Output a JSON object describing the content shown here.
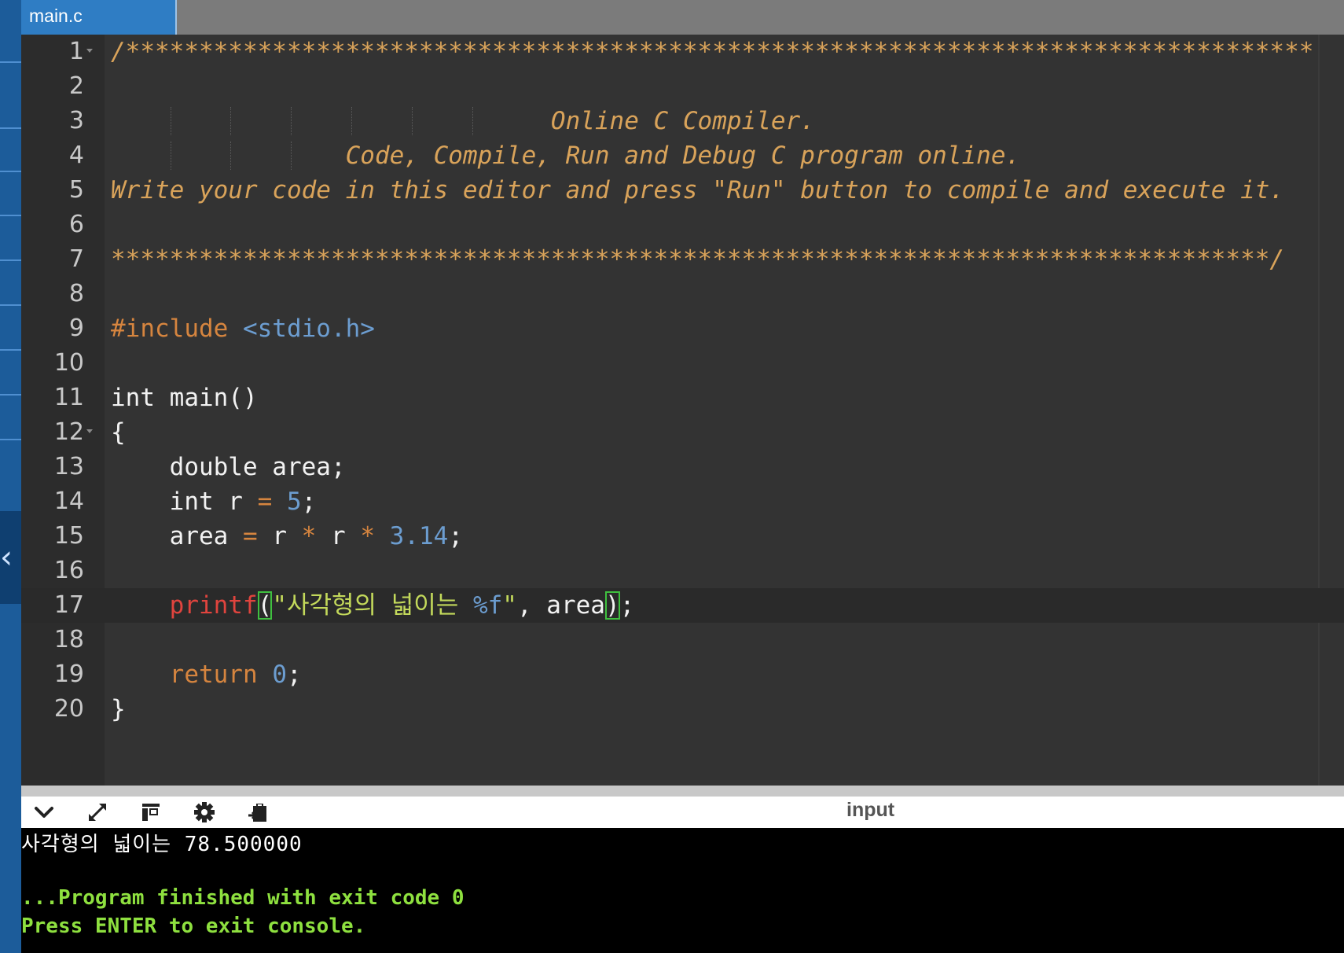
{
  "tabs": [
    {
      "label": "main.c"
    }
  ],
  "editor": {
    "line_numbers": [
      "1",
      "2",
      "3",
      "4",
      "5",
      "6",
      "7",
      "8",
      "9",
      "10",
      "11",
      "12",
      "13",
      "14",
      "15",
      "16",
      "17",
      "18",
      "19",
      "20"
    ],
    "active_line": 17,
    "folds": [
      1,
      12
    ],
    "comment": {
      "line1": "/*********************************************************************************",
      "line3": "                              Online C Compiler.",
      "line4": "                Code, Compile, Run and Debug C program online.",
      "line5": "Write your code in this editor and press \"Run\" button to compile and execute it.",
      "line7": "*******************************************************************************/"
    },
    "code": {
      "include_kw": "#include",
      "include_hdr": "<stdio.h>",
      "main_sig": "int main()",
      "open_brace": "{",
      "decl_area": "double area;",
      "decl_r_a": "int r ",
      "decl_r_eq": "=",
      "decl_r_val": "5",
      "decl_r_end": ";",
      "assign_lhs": "area ",
      "assign_eq": "=",
      "assign_r1": " r ",
      "assign_mul1": "*",
      "assign_r2": " r ",
      "assign_mul2": "*",
      "assign_num": "3.14",
      "assign_end": ";",
      "printf_fn": "printf",
      "printf_open": "(",
      "printf_str": "\"사각형의 넓이는 ",
      "printf_fmt": "%f",
      "printf_quote": "\"",
      "printf_sep": ", are",
      "printf_arg_end": "a",
      "printf_close": ")",
      "printf_semi": ";",
      "return_kw": "return",
      "return_val": "0",
      "return_end": ";",
      "close_brace": "}"
    }
  },
  "console": {
    "toolbar": {
      "icons": [
        "chevron-down-icon",
        "expand-icon",
        "layout-icon",
        "gear-icon",
        "clipboard-icon"
      ],
      "input_label": "input"
    },
    "output": "사각형의 넓이는 78.500000",
    "finished": "...Program finished with exit code 0",
    "press_enter": "Press ENTER to exit console."
  },
  "colors": {
    "tab_active": "#2f7dc4",
    "comment": "#d9a35a",
    "preprocessor": "#d6853f",
    "number": "#6c9dd0",
    "function": "#e0443e",
    "string": "#c3d95b",
    "console_green": "#8ee03f"
  }
}
